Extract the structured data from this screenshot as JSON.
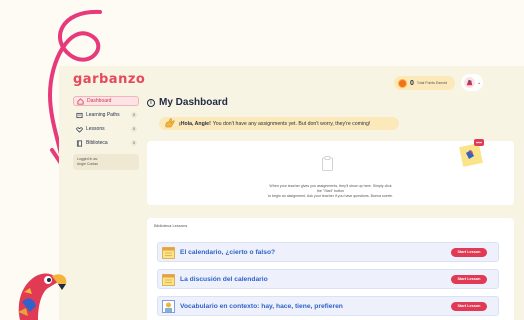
{
  "app": {
    "logo": "garbanzo"
  },
  "header": {
    "points_value": "0",
    "points_label": "Total Points Earned",
    "avatar_chevron": "⌄"
  },
  "sidebar": {
    "items": [
      {
        "label": "Dashboard",
        "icon": "home-icon",
        "active": true
      },
      {
        "label": "Learning Paths",
        "icon": "path-icon",
        "count": "0"
      },
      {
        "label": "Lessons",
        "icon": "heart-icon",
        "count": "0"
      },
      {
        "label": "Biblioteca",
        "icon": "book-icon",
        "count": "0"
      }
    ],
    "logged_in_label": "Logged in as:",
    "logged_in_user": "Angie Conlan"
  },
  "main": {
    "title": "My Dashboard",
    "banner": {
      "greeting": "¡Hola, Angie!",
      "message": "You don't have any assignments yet. But don't worry, they're coming!"
    },
    "empty_state": {
      "line1": "When your teacher gives you assignments, they'll show up here. Simply click the \"Start\" button",
      "line2": "to begin an assignment. Ask your teacher if you have questions. Buena suerte."
    },
    "biblioteca": {
      "title": "Biblioteca Lessons",
      "lessons": [
        {
          "title": "El calendario, ¿cierto o falso?",
          "button": "Start Lesson"
        },
        {
          "title": "La discusión del calendario",
          "button": "Start Lesson"
        },
        {
          "title": "Vocabulario en contexto: hay, hace, tiene, prefieren",
          "button": "Start Lesson"
        }
      ]
    }
  },
  "colors": {
    "accent": "#e03a55",
    "background": "#f8f4e4",
    "banner": "#fbe9b9",
    "link": "#2f63c9"
  }
}
